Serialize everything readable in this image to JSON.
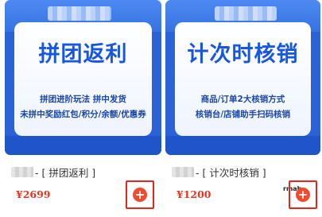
{
  "products": [
    {
      "banner_title": "拼团返利",
      "banner_line_1": "拼团进阶玩法 拼中发货",
      "banner_line_2": "未拼中奖励红包/积分/余额/优惠券",
      "name": "- [ 拼团返利 ]",
      "price": "¥2699",
      "add_icon": "plus-circle-icon"
    },
    {
      "banner_title": "计次时核销",
      "banner_line_1": "商品/订单2大核销方式",
      "banner_line_2": "核销台/店铺助手扫码核销",
      "name": "- [ 计次时核销 ]",
      "price": "¥1200",
      "add_icon": "plus-circle-icon",
      "logo_mark": "rmab"
    }
  ],
  "colors": {
    "banner_blue": "#2a62d8",
    "title_blue": "#1757e0",
    "price_red": "#e8341d",
    "add_button_red": "#f04a2f",
    "highlight_border_red": "#e8251b"
  }
}
